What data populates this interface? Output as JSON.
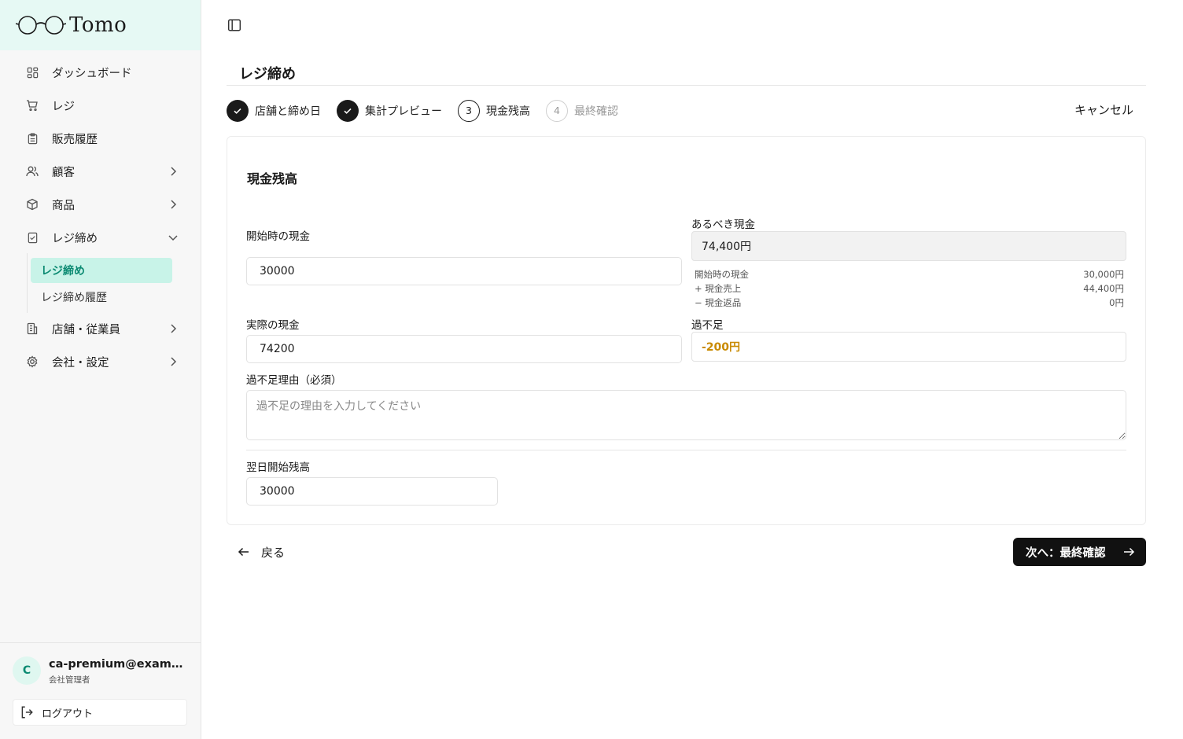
{
  "brand": {
    "name": "Tomo"
  },
  "sidebar": {
    "items": [
      {
        "label": "ダッシュボード",
        "icon": "dashboard-icon"
      },
      {
        "label": "レジ",
        "icon": "cart-icon"
      },
      {
        "label": "販売履歴",
        "icon": "clipboard-icon"
      },
      {
        "label": "顧客",
        "icon": "users-icon"
      },
      {
        "label": "商品",
        "icon": "package-icon"
      },
      {
        "label": "レジ締め",
        "icon": "checklist-icon"
      },
      {
        "label": "店舗・従業員",
        "icon": "building-icon"
      },
      {
        "label": "会社・設定",
        "icon": "gear-icon"
      }
    ],
    "subitems": [
      {
        "label": "レジ締め",
        "active": true
      },
      {
        "label": "レジ締め履歴",
        "active": false
      }
    ]
  },
  "user": {
    "initial": "C",
    "email": "ca-premium@example.com",
    "role": "会社管理者",
    "logout_label": "ログアウト"
  },
  "page": {
    "title": "レジ締め",
    "cancel_label": "キャンセル"
  },
  "steps": [
    {
      "number": "1",
      "label": "店舗と締め日",
      "state": "done"
    },
    {
      "number": "2",
      "label": "集計プレビュー",
      "state": "done"
    },
    {
      "number": "3",
      "label": "現金残高",
      "state": "current"
    },
    {
      "number": "4",
      "label": "最終確認",
      "state": "todo"
    }
  ],
  "form": {
    "section_title": "現金残高",
    "opening_cash": {
      "label": "開始時の現金",
      "value": "30000"
    },
    "expected_cash": {
      "label": "あるべき現金",
      "value": "74,400円",
      "breakdown": [
        {
          "label": "開始時の現金",
          "value": "30,000円"
        },
        {
          "label": "+ 現金売上",
          "value": "44,400円"
        },
        {
          "label": "− 現金返品",
          "value": "0円"
        }
      ]
    },
    "actual_cash": {
      "label": "実際の現金",
      "value": "74200"
    },
    "difference": {
      "label": "過不足",
      "value": "-200円",
      "color": "#c98a00"
    },
    "reason": {
      "label": "過不足理由（必須）",
      "placeholder": "過不足の理由を入力してください"
    },
    "next_day_opening": {
      "label": "翌日開始残高",
      "value": "30000"
    }
  },
  "footer": {
    "back_label": "戻る",
    "next_label": "次へ：最終確認"
  },
  "colors": {
    "accent": "#0b8a72",
    "accent_bg": "#c8f3e8",
    "brand_bg": "#e6f9f4",
    "warning": "#c98a00"
  }
}
